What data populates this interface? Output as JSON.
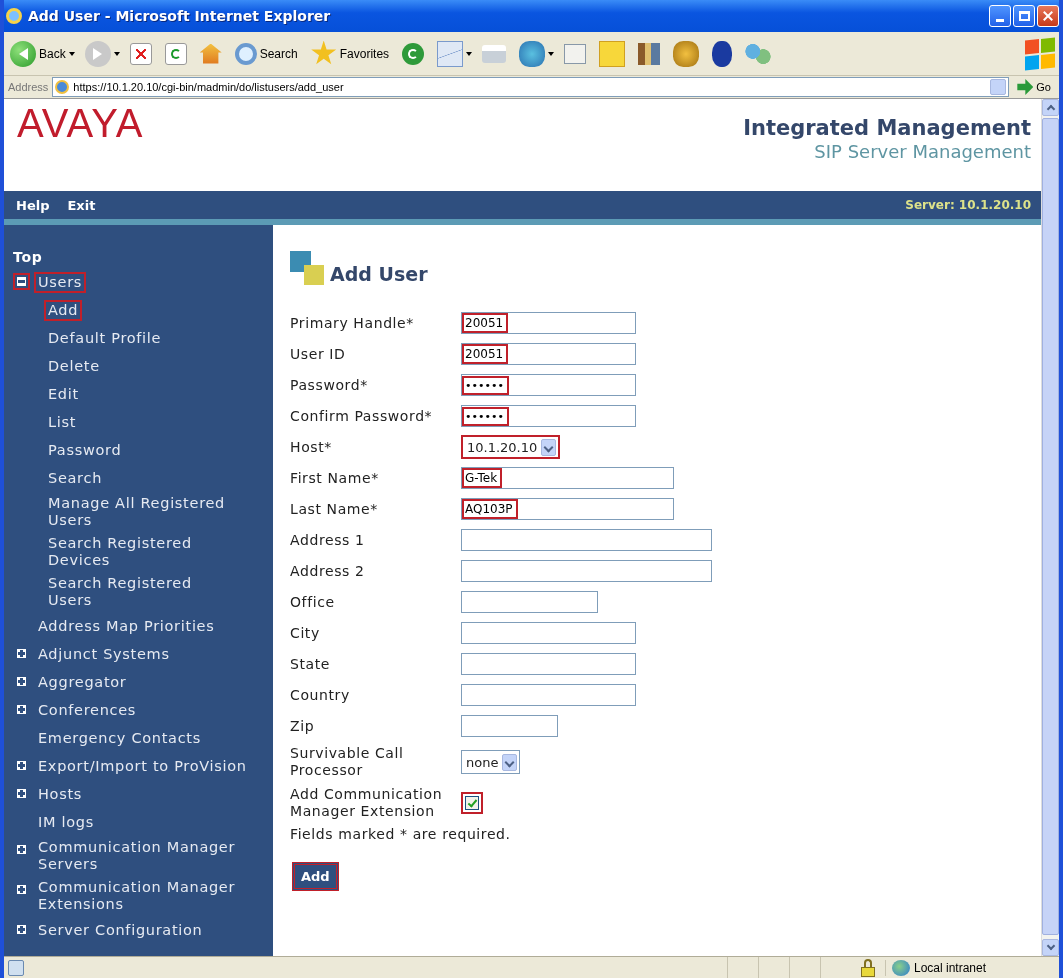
{
  "window": {
    "title": "Add User - Microsoft Internet Explorer"
  },
  "toolbar": [
    {
      "kind": "back",
      "label": "Back",
      "menu": true
    },
    {
      "kind": "forward",
      "menu": true
    },
    {
      "kind": "stop",
      "menu": false
    },
    {
      "kind": "refresh",
      "menu": false
    },
    {
      "kind": "home",
      "menu": false
    },
    {
      "kind": "search",
      "label": "Search",
      "menu": false
    },
    {
      "kind": "favorites",
      "label": "Favorites",
      "menu": false
    },
    {
      "kind": "history",
      "menu": false
    },
    {
      "kind": "mail",
      "menu": true
    },
    {
      "kind": "print",
      "menu": false
    },
    {
      "kind": "messenger",
      "menu": true
    },
    {
      "kind": "edit",
      "menu": false
    },
    {
      "kind": "note",
      "menu": false
    },
    {
      "kind": "research",
      "menu": false
    },
    {
      "kind": "phone",
      "menu": false
    },
    {
      "kind": "bluetooth",
      "menu": false
    },
    {
      "kind": "people",
      "menu": false
    }
  ],
  "address_bar": {
    "label": "Address",
    "url": "https://10.1.20.10/cgi-bin/madmin/do/listusers/add_user",
    "go": "Go"
  },
  "header": {
    "logo": "AVAYA",
    "title": "Integrated Management",
    "subtitle": "SIP Server Management"
  },
  "nav_bar": {
    "links": [
      "Help",
      "Exit"
    ],
    "server": "Server: 10.1.20.10"
  },
  "sidebar": {
    "top": "Top",
    "items": [
      {
        "kind": "folder",
        "label": "Users",
        "expanded": true,
        "highlighted": true,
        "children": [
          {
            "label": "Add",
            "highlighted": true
          },
          {
            "label": "Default Profile",
            "highlighted": false
          },
          {
            "label": "Delete",
            "highlighted": false
          },
          {
            "label": "Edit",
            "highlighted": false
          },
          {
            "label": "List",
            "highlighted": false
          },
          {
            "label": "Password",
            "highlighted": false
          },
          {
            "label": "Search",
            "highlighted": false
          },
          {
            "label": "Manage All Registered Users",
            "highlighted": false
          },
          {
            "label": "Search Registered Devices",
            "highlighted": false
          },
          {
            "label": "Search Registered Users",
            "highlighted": false
          }
        ]
      },
      {
        "kind": "link",
        "label": "Address Map Priorities"
      },
      {
        "kind": "folder",
        "label": "Adjunct Systems",
        "expanded": false,
        "highlighted": false
      },
      {
        "kind": "folder",
        "label": "Aggregator",
        "expanded": false,
        "highlighted": false
      },
      {
        "kind": "folder",
        "label": "Conferences",
        "expanded": false,
        "highlighted": false
      },
      {
        "kind": "link",
        "label": "Emergency Contacts"
      },
      {
        "kind": "folder",
        "label": "Export/Import to ProVision",
        "expanded": false,
        "highlighted": false
      },
      {
        "kind": "folder",
        "label": "Hosts",
        "expanded": false,
        "highlighted": false
      },
      {
        "kind": "link",
        "label": "IM logs"
      },
      {
        "kind": "folder",
        "label": "Communication Manager Servers",
        "expanded": false,
        "highlighted": false
      },
      {
        "kind": "folder",
        "label": "Communication Manager Extensions",
        "expanded": false,
        "highlighted": false
      },
      {
        "kind": "folder",
        "label": "Server Configuration",
        "expanded": false,
        "highlighted": false
      }
    ]
  },
  "form": {
    "title": "Add User",
    "fields": [
      {
        "kind": "text",
        "label": "Primary Handle*",
        "value": "20051",
        "highlighted": true
      },
      {
        "kind": "text",
        "label": "User ID",
        "value": "20051",
        "highlighted": true
      },
      {
        "kind": "password",
        "label": "Password*",
        "value": "••••••",
        "highlighted": true
      },
      {
        "kind": "password",
        "label": "Confirm Password*",
        "value": "••••••",
        "highlighted": true
      },
      {
        "kind": "select",
        "label": "Host*",
        "value": "10.1.20.10",
        "highlighted": true
      },
      {
        "kind": "text",
        "label": "First Name*",
        "value": "G-Tek",
        "highlighted": true
      },
      {
        "kind": "text",
        "label": "Last Name*",
        "value": "AQ103P",
        "highlighted": true
      },
      {
        "kind": "text",
        "label": "Address 1",
        "highlighted": false
      },
      {
        "kind": "text",
        "label": "Address 2",
        "highlighted": false
      },
      {
        "kind": "text",
        "label": "Office",
        "highlighted": false
      },
      {
        "kind": "text",
        "label": "City",
        "highlighted": false
      },
      {
        "kind": "text",
        "label": "State",
        "highlighted": false
      },
      {
        "kind": "text",
        "label": "Country",
        "highlighted": false
      },
      {
        "kind": "text",
        "label": "Zip",
        "highlighted": false
      },
      {
        "kind": "select",
        "label": "Survivable Call Processor",
        "value": "none"
      },
      {
        "kind": "checkbox",
        "label": "Add Communication Manager Extension",
        "checked": true,
        "highlighted": true
      }
    ],
    "note": "Fields marked * are required.",
    "submit": {
      "label": "Add",
      "highlighted": true
    }
  },
  "status_bar": {
    "zone": "Local intranet"
  }
}
